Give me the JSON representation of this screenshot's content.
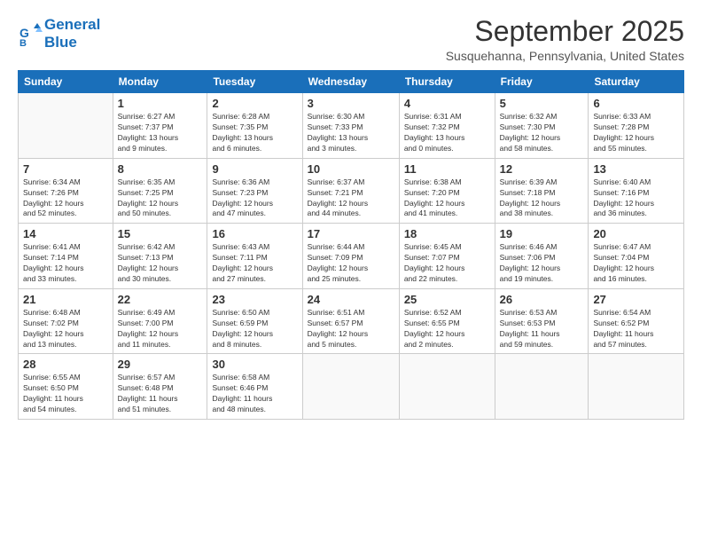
{
  "header": {
    "logo_line1": "General",
    "logo_line2": "Blue",
    "month_title": "September 2025",
    "location": "Susquehanna, Pennsylvania, United States"
  },
  "weekdays": [
    "Sunday",
    "Monday",
    "Tuesday",
    "Wednesday",
    "Thursday",
    "Friday",
    "Saturday"
  ],
  "weeks": [
    [
      {
        "day": "",
        "info": ""
      },
      {
        "day": "1",
        "info": "Sunrise: 6:27 AM\nSunset: 7:37 PM\nDaylight: 13 hours\nand 9 minutes."
      },
      {
        "day": "2",
        "info": "Sunrise: 6:28 AM\nSunset: 7:35 PM\nDaylight: 13 hours\nand 6 minutes."
      },
      {
        "day": "3",
        "info": "Sunrise: 6:30 AM\nSunset: 7:33 PM\nDaylight: 13 hours\nand 3 minutes."
      },
      {
        "day": "4",
        "info": "Sunrise: 6:31 AM\nSunset: 7:32 PM\nDaylight: 13 hours\nand 0 minutes."
      },
      {
        "day": "5",
        "info": "Sunrise: 6:32 AM\nSunset: 7:30 PM\nDaylight: 12 hours\nand 58 minutes."
      },
      {
        "day": "6",
        "info": "Sunrise: 6:33 AM\nSunset: 7:28 PM\nDaylight: 12 hours\nand 55 minutes."
      }
    ],
    [
      {
        "day": "7",
        "info": "Sunrise: 6:34 AM\nSunset: 7:26 PM\nDaylight: 12 hours\nand 52 minutes."
      },
      {
        "day": "8",
        "info": "Sunrise: 6:35 AM\nSunset: 7:25 PM\nDaylight: 12 hours\nand 50 minutes."
      },
      {
        "day": "9",
        "info": "Sunrise: 6:36 AM\nSunset: 7:23 PM\nDaylight: 12 hours\nand 47 minutes."
      },
      {
        "day": "10",
        "info": "Sunrise: 6:37 AM\nSunset: 7:21 PM\nDaylight: 12 hours\nand 44 minutes."
      },
      {
        "day": "11",
        "info": "Sunrise: 6:38 AM\nSunset: 7:20 PM\nDaylight: 12 hours\nand 41 minutes."
      },
      {
        "day": "12",
        "info": "Sunrise: 6:39 AM\nSunset: 7:18 PM\nDaylight: 12 hours\nand 38 minutes."
      },
      {
        "day": "13",
        "info": "Sunrise: 6:40 AM\nSunset: 7:16 PM\nDaylight: 12 hours\nand 36 minutes."
      }
    ],
    [
      {
        "day": "14",
        "info": "Sunrise: 6:41 AM\nSunset: 7:14 PM\nDaylight: 12 hours\nand 33 minutes."
      },
      {
        "day": "15",
        "info": "Sunrise: 6:42 AM\nSunset: 7:13 PM\nDaylight: 12 hours\nand 30 minutes."
      },
      {
        "day": "16",
        "info": "Sunrise: 6:43 AM\nSunset: 7:11 PM\nDaylight: 12 hours\nand 27 minutes."
      },
      {
        "day": "17",
        "info": "Sunrise: 6:44 AM\nSunset: 7:09 PM\nDaylight: 12 hours\nand 25 minutes."
      },
      {
        "day": "18",
        "info": "Sunrise: 6:45 AM\nSunset: 7:07 PM\nDaylight: 12 hours\nand 22 minutes."
      },
      {
        "day": "19",
        "info": "Sunrise: 6:46 AM\nSunset: 7:06 PM\nDaylight: 12 hours\nand 19 minutes."
      },
      {
        "day": "20",
        "info": "Sunrise: 6:47 AM\nSunset: 7:04 PM\nDaylight: 12 hours\nand 16 minutes."
      }
    ],
    [
      {
        "day": "21",
        "info": "Sunrise: 6:48 AM\nSunset: 7:02 PM\nDaylight: 12 hours\nand 13 minutes."
      },
      {
        "day": "22",
        "info": "Sunrise: 6:49 AM\nSunset: 7:00 PM\nDaylight: 12 hours\nand 11 minutes."
      },
      {
        "day": "23",
        "info": "Sunrise: 6:50 AM\nSunset: 6:59 PM\nDaylight: 12 hours\nand 8 minutes."
      },
      {
        "day": "24",
        "info": "Sunrise: 6:51 AM\nSunset: 6:57 PM\nDaylight: 12 hours\nand 5 minutes."
      },
      {
        "day": "25",
        "info": "Sunrise: 6:52 AM\nSunset: 6:55 PM\nDaylight: 12 hours\nand 2 minutes."
      },
      {
        "day": "26",
        "info": "Sunrise: 6:53 AM\nSunset: 6:53 PM\nDaylight: 11 hours\nand 59 minutes."
      },
      {
        "day": "27",
        "info": "Sunrise: 6:54 AM\nSunset: 6:52 PM\nDaylight: 11 hours\nand 57 minutes."
      }
    ],
    [
      {
        "day": "28",
        "info": "Sunrise: 6:55 AM\nSunset: 6:50 PM\nDaylight: 11 hours\nand 54 minutes."
      },
      {
        "day": "29",
        "info": "Sunrise: 6:57 AM\nSunset: 6:48 PM\nDaylight: 11 hours\nand 51 minutes."
      },
      {
        "day": "30",
        "info": "Sunrise: 6:58 AM\nSunset: 6:46 PM\nDaylight: 11 hours\nand 48 minutes."
      },
      {
        "day": "",
        "info": ""
      },
      {
        "day": "",
        "info": ""
      },
      {
        "day": "",
        "info": ""
      },
      {
        "day": "",
        "info": ""
      }
    ]
  ]
}
